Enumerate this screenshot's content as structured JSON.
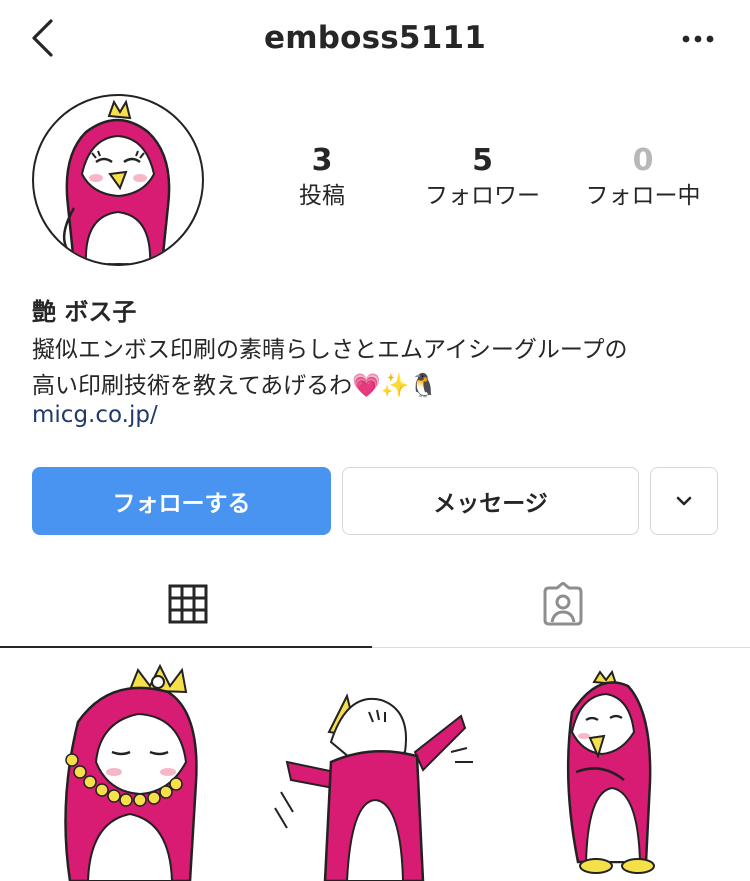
{
  "header": {
    "username": "emboss5111",
    "back_icon": "chevron-left-icon",
    "more_icon": "more-horizontal-icon"
  },
  "stats": {
    "posts": {
      "count": "3",
      "label": "投稿"
    },
    "followers": {
      "count": "5",
      "label": "フォロワー"
    },
    "following": {
      "count": "0",
      "label": "フォロー中"
    }
  },
  "profile": {
    "name": "艶 ボス子",
    "bio_line1": "擬似エンボス印刷の素晴らしさとエムアイシーグループの",
    "bio_line2": "高い印刷技術を教えてあげるわ💗✨🐧",
    "link": "micg.co.jp/"
  },
  "actions": {
    "follow_label": "フォローする",
    "message_label": "メッセージ",
    "dropdown_icon": "chevron-down-icon"
  },
  "tabs": {
    "grid_icon": "grid-icon",
    "tagged_icon": "tagged-person-icon"
  },
  "colors": {
    "accent": "#4894f0",
    "mascot_pink": "#d81b73",
    "mascot_yellow": "#f6e04a",
    "link": "#1f3a6b"
  }
}
